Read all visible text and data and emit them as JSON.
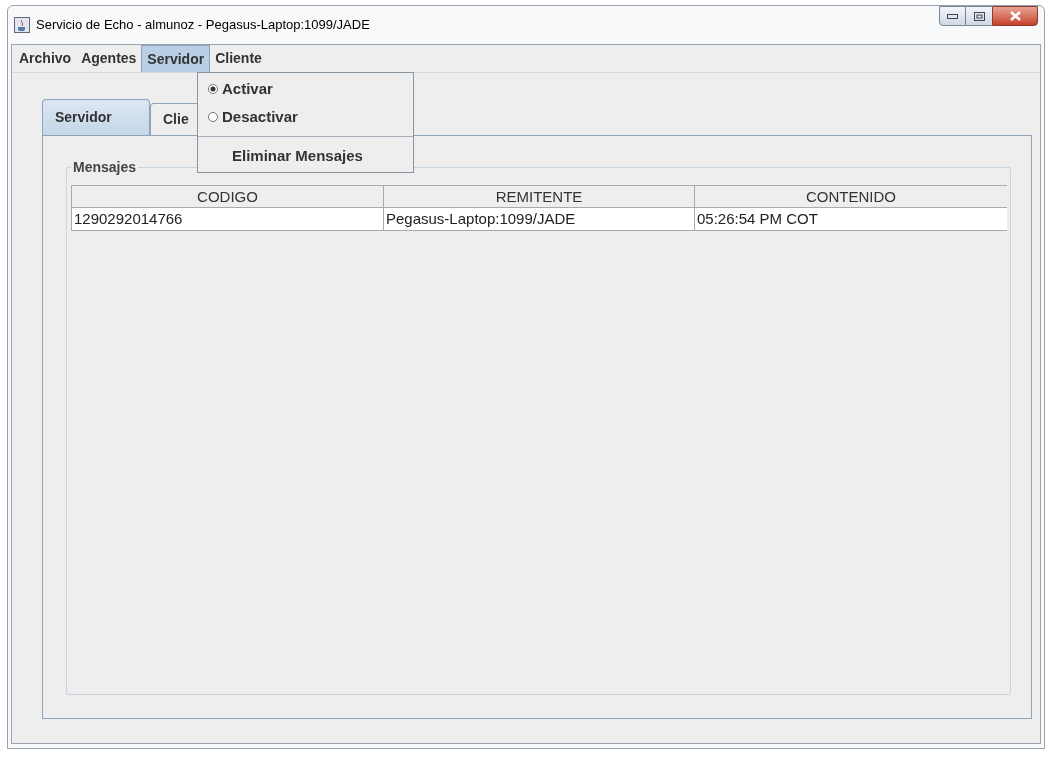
{
  "window": {
    "title": "Servicio de Echo - almunoz - Pegasus-Laptop:1099/JADE"
  },
  "menu_bar": [
    {
      "label": "Archivo",
      "selected": false
    },
    {
      "label": "Agentes",
      "selected": false
    },
    {
      "label": "Servidor",
      "selected": true
    },
    {
      "label": "Cliente",
      "selected": false
    }
  ],
  "menu_popup": {
    "items": [
      {
        "kind": "radio",
        "label": "Activar",
        "selected": true
      },
      {
        "kind": "radio",
        "label": "Desactivar",
        "selected": false
      },
      {
        "kind": "separator"
      },
      {
        "kind": "item",
        "label": "Eliminar Mensajes"
      }
    ]
  },
  "tabs": [
    {
      "label": "Servidor",
      "selected": true
    },
    {
      "label": "Clie",
      "selected": false
    }
  ],
  "panel": {
    "title": "Mensajes"
  },
  "table": {
    "columns": [
      "CODIGO",
      "REMITENTE",
      "CONTENIDO"
    ],
    "rows": [
      [
        "1290292014766",
        "Pegasus-Laptop:1099/JADE",
        "05:26:54 PM COT"
      ]
    ]
  }
}
